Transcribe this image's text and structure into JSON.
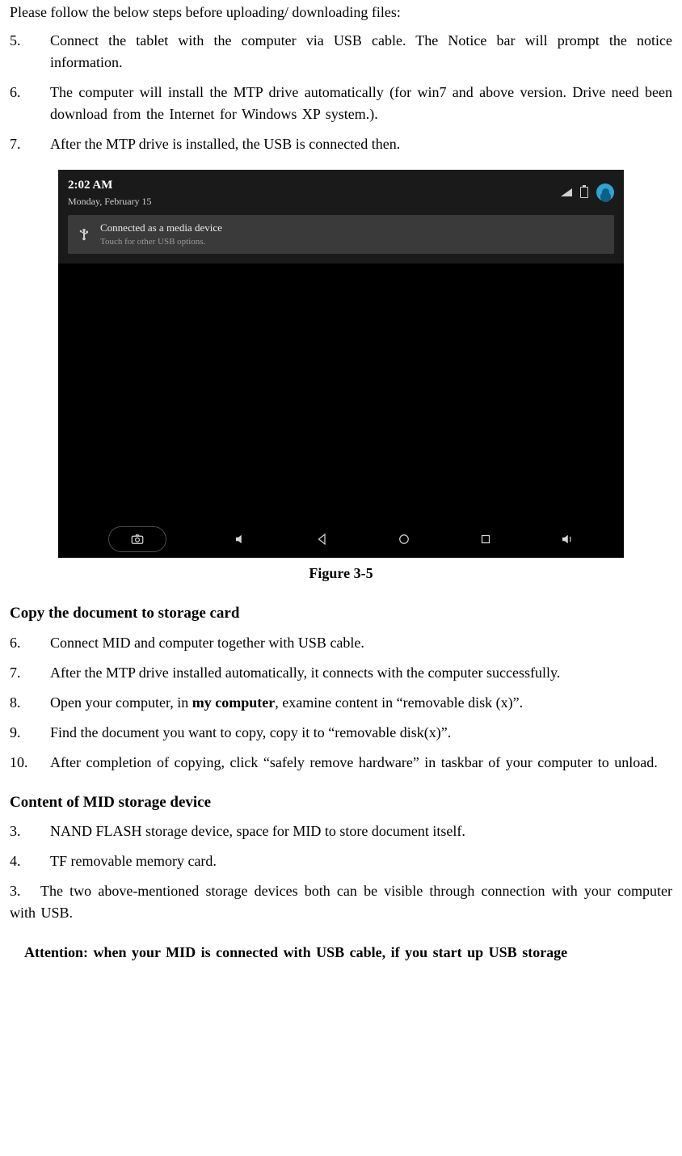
{
  "intro": "Please follow the below steps before uploading/ downloading files:",
  "list1": {
    "5": {
      "n": "5.",
      "t": "Connect the tablet with the computer via USB cable. The Notice bar will prompt the notice information."
    },
    "6": {
      "n": "6.",
      "t": "The computer will install the MTP drive automatically (for win7 and above version. Drive need been download from the Internet for Windows XP system.)."
    },
    "7": {
      "n": "7.",
      "t": "After the MTP drive is installed, the USB is connected then."
    }
  },
  "figure": {
    "time": "2:02 AM",
    "date": "Monday, February 15",
    "notif_title": "Connected as a media device",
    "notif_sub": "Touch for other USB options.",
    "caption": "Figure 3-5"
  },
  "h2a": "Copy the document to storage card",
  "list2": {
    "6": {
      "n": "6.",
      "t": "Connect MID and computer together with USB cable."
    },
    "7": {
      "n": "7.",
      "t": "After the MTP drive installed automatically, it connects with the computer successfully."
    },
    "8": {
      "n": "8.",
      "pre": "Open your computer, in ",
      "bold": "my computer",
      "post": ", examine content in “removable disk (x)”."
    },
    "9": {
      "n": "9.",
      "t": "Find the document you want to copy, copy it to “removable disk(x)”."
    },
    "10": {
      "n": "10.",
      "t": "After completion of copying, click “safely remove hardware” in taskbar of your computer to unload."
    }
  },
  "h2b": "Content of MID storage device",
  "list3": {
    "3": {
      "n": "3.",
      "t": "NAND FLASH storage device, space for MID to store document itself."
    },
    "4": {
      "n": "4.",
      "t": "TF removable memory card."
    }
  },
  "para": {
    "n": "3.",
    "t": "The two above-mentioned storage devices both can be visible through connection with your computer with USB."
  },
  "attention": "Attention: when your MID is connected with USB cable, if you start up USB storage"
}
